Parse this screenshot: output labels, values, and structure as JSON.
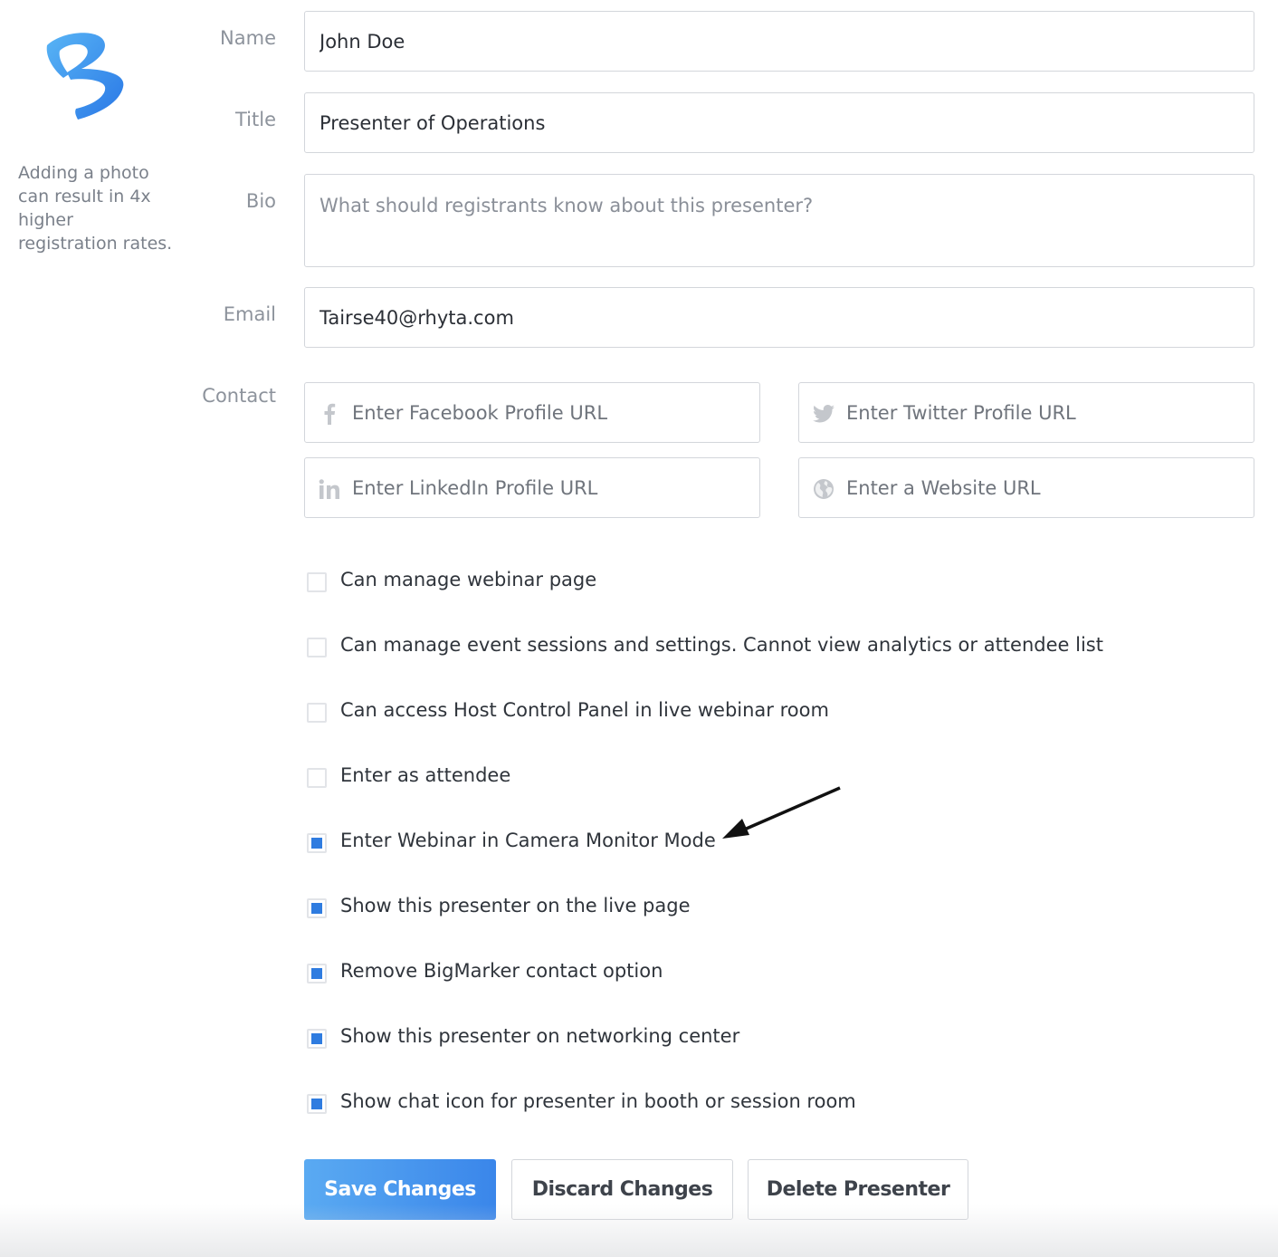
{
  "photo_hint": "Adding a photo can result in 4x higher registration rates.",
  "form": {
    "name": {
      "label": "Name",
      "value": "John Doe"
    },
    "title": {
      "label": "Title",
      "value": "Presenter of Operations"
    },
    "bio": {
      "label": "Bio",
      "value": "",
      "placeholder": "What should registrants know about this presenter?"
    },
    "email": {
      "label": "Email",
      "value": "Tairse40@rhyta.com"
    },
    "contact": {
      "label": "Contact",
      "facebook_placeholder": "Enter Facebook Profile URL",
      "twitter_placeholder": "Enter Twitter Profile URL",
      "linkedin_placeholder": "Enter LinkedIn Profile URL",
      "website_placeholder": "Enter a Website URL"
    }
  },
  "permissions": [
    {
      "label": "Can manage webinar page",
      "checked": false
    },
    {
      "label": "Can manage event sessions and settings. Cannot view analytics or attendee list",
      "checked": false
    },
    {
      "label": "Can access Host Control Panel in live webinar room",
      "checked": false
    },
    {
      "label": "Enter as attendee",
      "checked": false
    },
    {
      "label": "Enter Webinar in Camera Monitor Mode",
      "checked": true
    },
    {
      "label": "Show this presenter on the live page",
      "checked": true
    },
    {
      "label": "Remove BigMarker contact option",
      "checked": true
    },
    {
      "label": "Show this presenter on networking center",
      "checked": true
    },
    {
      "label": "Show chat icon for presenter in booth or session room",
      "checked": true
    }
  ],
  "buttons": {
    "save": "Save Changes",
    "discard": "Discard Changes",
    "delete": "Delete Presenter"
  },
  "icons": {
    "logo": "bigmarker-logo",
    "facebook": "facebook-icon",
    "twitter": "twitter-icon",
    "linkedin": "linkedin-icon",
    "website": "globe-icon",
    "annotation": "arrow-annotation"
  },
  "colors": {
    "accent": "#2f7ce0",
    "button_gradient_start": "#5aaaf2",
    "button_gradient_end": "#3a86ea",
    "label_gray": "#8d939c",
    "border": "#d3d6db"
  }
}
